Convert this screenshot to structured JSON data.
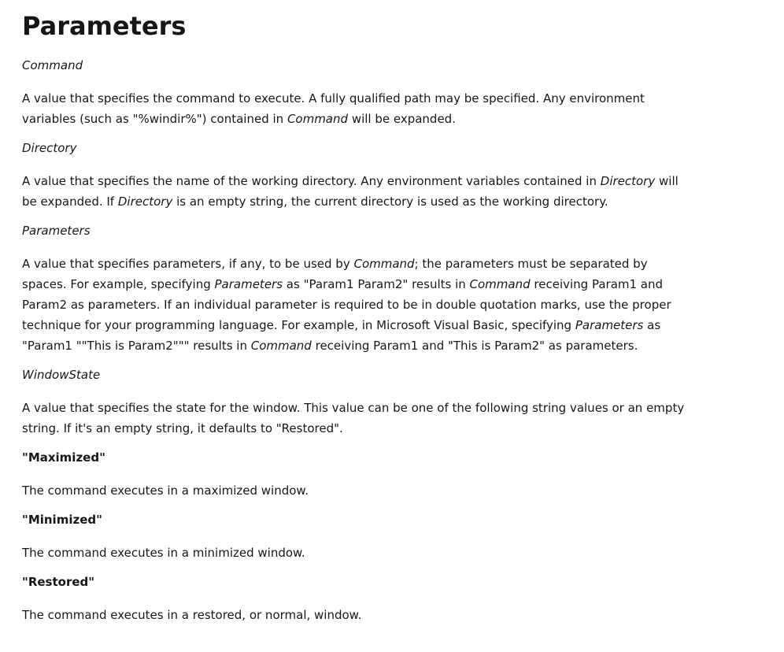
{
  "title": "Parameters",
  "params": [
    {
      "name": "Command",
      "desc_parts": [
        "A value that specifies the command to execute. A fully qualified path may be specified. Any environment variables (such as \"%windir%\") contained in ",
        "Command",
        " will be expanded."
      ]
    },
    {
      "name": "Directory",
      "desc_parts": [
        "A value that specifies the name of the working directory. Any environment variables contained in ",
        "Directory",
        " will be expanded. If ",
        "Directory",
        " is an empty string, the current directory is used as the working directory."
      ]
    },
    {
      "name": "Parameters",
      "desc_parts": [
        "A value that specifies parameters, if any, to be used by ",
        "Command",
        "; the parameters must be separated by spaces. For example, specifying ",
        "Parameters",
        " as \"Param1 Param2\" results in ",
        "Command",
        " receiving Param1 and Param2 as parameters. If an individual parameter is required to be in double quotation marks, use the proper technique for your programming language. For example, in Microsoft Visual Basic, specifying ",
        "Parameters",
        " as \"Param1 \"\"This is Param2\"\"\" results in ",
        "Command",
        " receiving Param1 and \"This is Param2\" as parameters."
      ]
    },
    {
      "name": "WindowState",
      "desc_parts": [
        "A value that specifies the state for the window. This value can be one of the following string values or an empty string. If it's an empty string, it defaults to \"Restored\"."
      ]
    }
  ],
  "values": [
    {
      "name": "\"Maximized\"",
      "desc": "The command executes in a maximized window."
    },
    {
      "name": "\"Minimized\"",
      "desc": "The command executes in a minimized window."
    },
    {
      "name": "\"Restored\"",
      "desc": "The command executes in a restored, or normal, window."
    }
  ]
}
